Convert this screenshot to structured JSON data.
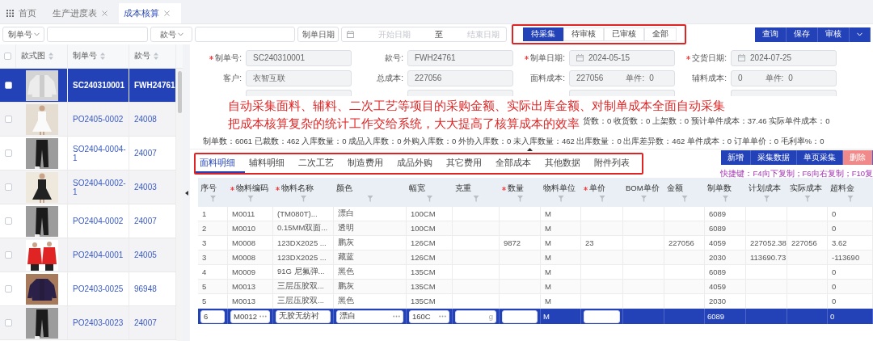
{
  "tabs": [
    {
      "label": "首页",
      "kind": "home",
      "closable": false,
      "selected": false
    },
    {
      "label": "生产进度表",
      "kind": "page",
      "closable": true,
      "selected": false
    },
    {
      "label": "成本核算",
      "kind": "page",
      "closable": true,
      "selected": true
    }
  ],
  "filters": {
    "order_select": "制单号",
    "style_select": "款号",
    "date_select": "制单日期",
    "start_placeholder": "开始日期",
    "separator": "至",
    "end_placeholder": "结束日期"
  },
  "status_tabs": [
    {
      "label": "待采集",
      "selected": true
    },
    {
      "label": "待审核",
      "selected": false
    },
    {
      "label": "已审核",
      "selected": false
    },
    {
      "label": "全部",
      "selected": false
    }
  ],
  "actions": [
    "查询",
    "保存",
    "审核"
  ],
  "orders": {
    "columns": [
      "款式图",
      "制单号",
      "款号"
    ],
    "all_checked": false,
    "rows": [
      {
        "order_no": "SC240310001",
        "style_no": "FWH24761",
        "selected": true,
        "checked": false
      },
      {
        "order_no": "PO2405-0002",
        "style_no": "24008",
        "selected": false,
        "checked": false
      },
      {
        "order_no": "SO2404-0004-1",
        "style_no": "24007",
        "selected": false,
        "checked": false
      },
      {
        "order_no": "SO2404-0002-1",
        "style_no": "24003",
        "selected": false,
        "checked": false
      },
      {
        "order_no": "PO2404-0002",
        "style_no": "24007",
        "selected": false,
        "checked": false
      },
      {
        "order_no": "PO2404-0001",
        "style_no": "24005",
        "selected": false,
        "checked": false
      },
      {
        "order_no": "PO2403-0025",
        "style_no": "96948",
        "selected": false,
        "checked": false
      },
      {
        "order_no": "PO2403-0023",
        "style_no": "24007",
        "selected": false,
        "checked": false
      }
    ]
  },
  "form": {
    "rows": [
      [
        {
          "kind": "text",
          "label": "制单号:",
          "value": "SC240310001",
          "required": true
        },
        {
          "kind": "text",
          "label": "款号:",
          "value": "FWH24761",
          "required": false
        },
        {
          "kind": "date",
          "label": "制单日期:",
          "value": "2024-05-15",
          "required": true
        },
        {
          "kind": "date",
          "label": "交货日期:",
          "value": "2024-07-25",
          "required": true
        }
      ],
      [
        {
          "kind": "text",
          "label": "客户:",
          "value": "衣智互联",
          "required": false
        },
        {
          "kind": "text",
          "label": "总成本:",
          "value": "227056",
          "required": false
        },
        {
          "kind": "split",
          "label": "面料成本:",
          "value": "227056",
          "sub_label": "单件:",
          "sub_value": "0",
          "required": false
        },
        {
          "kind": "split",
          "label": "辅料成本:",
          "value": "0",
          "sub_label": "单件:",
          "sub_value": "0",
          "required": false
        }
      ]
    ],
    "stats": [
      "货数：0 收货数：0 上架数：0 预计单件成本：37.46 实际单件成本：0",
      "制单数：6061 已裁数：462 入库数量：0 成品入库数：0 外购入库数：0 外协入库数：0 未入库数量：462 出库数量：0 出库差异数：462 单件成本：0 订单单价：0 毛利率%：0"
    ]
  },
  "annotation": [
    "自动采集面料、辅料、二次工艺等项目的采购金额、实际出库金额、对制单成本全面自动采集",
    "把成本核算复杂的统计工作交给系统，大大提高了核算成本的效率"
  ],
  "detail_tabs": [
    {
      "label": "面料明细",
      "selected": true
    },
    {
      "label": "辅料明细",
      "selected": false
    },
    {
      "label": "二次工艺",
      "selected": false
    },
    {
      "label": "制造费用",
      "selected": false
    },
    {
      "label": "成品外购",
      "selected": false
    },
    {
      "label": "其它费用",
      "selected": false
    },
    {
      "label": "全部成本",
      "selected": false
    },
    {
      "label": "其他数据",
      "selected": false
    },
    {
      "label": "附件列表",
      "selected": false
    }
  ],
  "detail_actions": [
    {
      "label": "新增",
      "kind": "primary"
    },
    {
      "label": "采集数据",
      "kind": "primary"
    },
    {
      "label": "单页采集",
      "kind": "primary"
    },
    {
      "label": "删除",
      "kind": "danger"
    }
  ],
  "shortcut_hint": "快捷键：F4向下复制；F6向右复制；F10复",
  "materials": {
    "columns": [
      {
        "label": "序号",
        "required": false
      },
      {
        "label": "物料编码",
        "required": true
      },
      {
        "label": "物料名称",
        "required": true
      },
      {
        "label": "颜色",
        "required": false
      },
      {
        "label": "幅宽",
        "required": false
      },
      {
        "label": "克重",
        "required": false
      },
      {
        "label": "数量",
        "required": true
      },
      {
        "label": "物料单位",
        "required": false
      },
      {
        "label": "单价",
        "required": true
      },
      {
        "label": "BOM单价",
        "required": false
      },
      {
        "label": "金额",
        "required": false
      },
      {
        "label": "制单数",
        "required": false
      },
      {
        "label": "计划成本",
        "required": false
      },
      {
        "label": "实际成本",
        "required": false
      },
      {
        "label": "超料金",
        "required": false
      }
    ],
    "rows": [
      [
        "1",
        "M0011",
        "(TM080T)...",
        "漂白",
        "100CM",
        null,
        null,
        "M",
        null,
        null,
        null,
        "6089",
        null,
        null,
        "0"
      ],
      [
        "2",
        "M0010",
        "0.15MM双面...",
        "透明",
        "100CM",
        null,
        null,
        "M",
        null,
        null,
        null,
        "6089",
        null,
        null,
        "0"
      ],
      [
        "3",
        "M0008",
        "123DX2025 ...",
        "鹏灰",
        "126CM",
        null,
        "9872",
        "M",
        "23",
        null,
        "227056",
        "4059",
        "227052.38",
        "227056",
        "3.62"
      ],
      [
        "3",
        "M0008",
        "123DX2025 ...",
        "藏蓝",
        "126CM",
        null,
        null,
        "M",
        null,
        null,
        null,
        "2030",
        "113690.73",
        null,
        "-113690"
      ],
      [
        "4",
        "M0009",
        "91G 尼氟弹...",
        "黑色",
        "135CM",
        null,
        null,
        "M",
        null,
        null,
        null,
        "6089",
        null,
        null,
        "0"
      ],
      [
        "5",
        "M0013",
        "三层压胶双...",
        "鹏灰",
        "135CM",
        null,
        null,
        "M",
        null,
        null,
        null,
        "4059",
        null,
        null,
        "0"
      ],
      [
        "5",
        "M0013",
        "三层压胶双...",
        "黑色",
        "135CM",
        null,
        null,
        "M",
        null,
        null,
        null,
        "2030",
        null,
        null,
        "0"
      ]
    ],
    "edit_row": [
      {
        "kind": "input",
        "value": "6"
      },
      {
        "kind": "picker",
        "value": "M0012"
      },
      {
        "kind": "input",
        "value": "无胶无纺衬"
      },
      {
        "kind": "picker",
        "value": "漂白"
      },
      {
        "kind": "picker",
        "value": "160C"
      },
      {
        "kind": "unit",
        "unit": "g"
      },
      {
        "kind": "input"
      },
      {
        "kind": "text",
        "value": "M"
      },
      {
        "kind": "input"
      },
      {
        "kind": "text"
      },
      {
        "kind": "text"
      },
      {
        "kind": "text",
        "value": "6089"
      },
      {
        "kind": "text"
      },
      {
        "kind": "text"
      },
      {
        "kind": "text",
        "value": "0"
      }
    ]
  }
}
